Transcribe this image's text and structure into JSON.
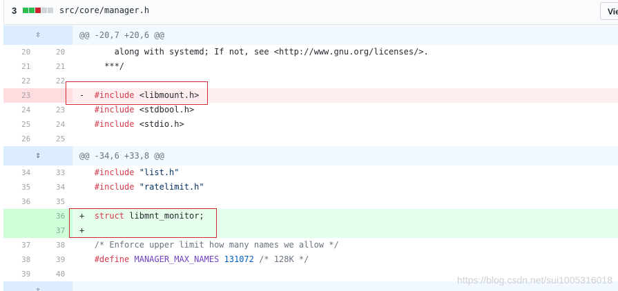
{
  "file": {
    "change_count": "3",
    "diffstat_colors": [
      "#2cbe4e",
      "#2cbe4e",
      "#cb2431",
      "#d1d5da",
      "#d1d5da"
    ],
    "path": "src/core/manager.h",
    "view_button": "View"
  },
  "rows": [
    {
      "type": "hunk",
      "icon": "expand-icon",
      "code": "@@ -20,7 +20,6 @@"
    },
    {
      "type": "ctx",
      "old": "20",
      "new": "20",
      "code": "    along with systemd; If not, see <http://www.gnu.org/licenses/>."
    },
    {
      "type": "ctx",
      "old": "21",
      "new": "21",
      "code": "  ***/"
    },
    {
      "type": "ctx",
      "old": "22",
      "new": "22",
      "code": ""
    },
    {
      "type": "del",
      "old": "23",
      "new": "",
      "sign": "-",
      "kw": "#include",
      "rest": " <libmount.h>"
    },
    {
      "type": "ctx",
      "old": "24",
      "new": "23",
      "kw": "#include",
      "rest": " <stdbool.h>"
    },
    {
      "type": "ctx",
      "old": "25",
      "new": "24",
      "kw": "#include",
      "rest": " <stdio.h>"
    },
    {
      "type": "ctx",
      "old": "26",
      "new": "25",
      "code": ""
    },
    {
      "type": "hunk",
      "icon": "expand-both-icon",
      "code": "@@ -34,6 +33,8 @@"
    },
    {
      "type": "ctx",
      "old": "34",
      "new": "33",
      "kw": "#include",
      "str": " \"list.h\""
    },
    {
      "type": "ctx",
      "old": "35",
      "new": "34",
      "kw": "#include",
      "str": " \"ratelimit.h\""
    },
    {
      "type": "ctx",
      "old": "36",
      "new": "35",
      "code": ""
    },
    {
      "type": "add",
      "old": "",
      "new": "36",
      "sign": "+",
      "kw": "struct",
      "rest": " libmnt_monitor;"
    },
    {
      "type": "add",
      "old": "",
      "new": "37",
      "sign": "+",
      "code": ""
    },
    {
      "type": "ctx",
      "old": "37",
      "new": "38",
      "comment": "/* Enforce upper limit how many names we allow */"
    },
    {
      "type": "ctx",
      "old": "38",
      "new": "39",
      "define": "#define",
      "macro": " MANAGER_MAX_NAMES",
      "number": " 131072",
      "comment2": " /* 128K */"
    },
    {
      "type": "ctx",
      "old": "39",
      "new": "40",
      "code": ""
    },
    {
      "type": "hunk",
      "icon": "expand-icon",
      "code": ""
    }
  ],
  "watermark": "https://blog.csdn.net/sui1005316018"
}
